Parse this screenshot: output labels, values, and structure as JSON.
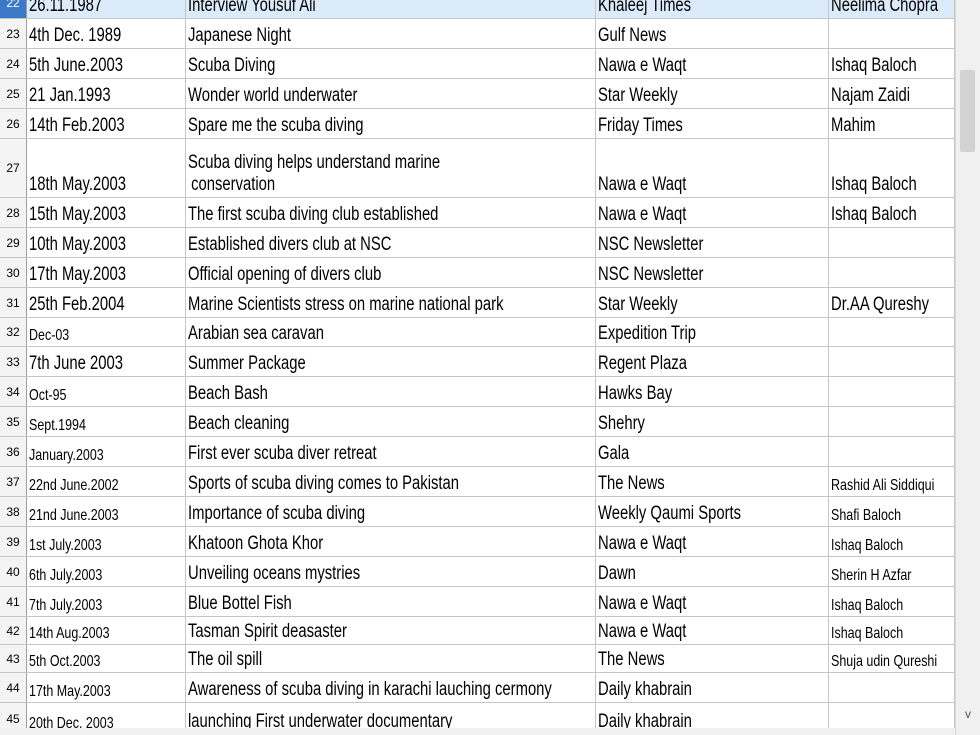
{
  "rows": [
    {
      "n": "22",
      "date": "26.11.1987",
      "title": "Interview Yousuf Ali",
      "source": "Khaleej Times",
      "author": "Neelima Chopra"
    },
    {
      "n": "23",
      "date": "4th Dec. 1989",
      "title": "Japanese Night",
      "source": "Gulf News",
      "author": ""
    },
    {
      "n": "24",
      "date": "5th June.2003",
      "title": "Scuba Diving",
      "source": "Nawa e Waqt",
      "author": "Ishaq Baloch"
    },
    {
      "n": "25",
      "date": "21 Jan.1993",
      "title": "Wonder world underwater",
      "source": "Star Weekly",
      "author": "Najam Zaidi"
    },
    {
      "n": "26",
      "date": "14th Feb.2003",
      "title": "Spare me the scuba diving",
      "source": "Friday Times",
      "author": "Mahim"
    },
    {
      "n": "27",
      "date": "18th May.2003",
      "title": "Scuba diving helps understand marine",
      "title2": "conservation",
      "source": "Nawa e Waqt",
      "author": "Ishaq Baloch"
    },
    {
      "n": "28",
      "date": "15th May.2003",
      "title": "The first scuba diving club established",
      "source": "Nawa e Waqt",
      "author": "Ishaq Baloch"
    },
    {
      "n": "29",
      "date": "10th May.2003",
      "title": "Established divers club at NSC",
      "source": "NSC Newsletter",
      "author": ""
    },
    {
      "n": "30",
      "date": "17th May.2003",
      "title": "Official opening of divers club",
      "source": "NSC Newsletter",
      "author": ""
    },
    {
      "n": "31",
      "date": "25th Feb.2004",
      "title": "Marine Scientists stress on marine national park",
      "source": "Star Weekly",
      "author": "Dr.AA Qureshy"
    },
    {
      "n": "32",
      "date": "Dec-03",
      "title": "Arabian sea caravan",
      "source": "Expedition Trip",
      "author": ""
    },
    {
      "n": "33",
      "date": "7th June 2003",
      "title": "Summer Package",
      "source": "Regent Plaza",
      "author": ""
    },
    {
      "n": "34",
      "date": "Oct-95",
      "title": "Beach Bash",
      "source": "Hawks Bay",
      "author": ""
    },
    {
      "n": "35",
      "date": "Sept.1994",
      "title": "Beach cleaning",
      "source": "Shehry",
      "author": ""
    },
    {
      "n": "36",
      "date": "January.2003",
      "title": "First ever scuba diver retreat",
      "source": "Gala",
      "author": ""
    },
    {
      "n": "37",
      "date": "22nd June.2002",
      "title": "Sports of scuba diving comes to Pakistan",
      "source": "The News",
      "author": "Rashid Ali Siddiqui"
    },
    {
      "n": "38",
      "date": "21nd June.2003",
      "title": "Importance of scuba diving",
      "source": "Weekly Qaumi Sports",
      "author": "Shafi Baloch"
    },
    {
      "n": "39",
      "date": "1st July.2003",
      "title": "Khatoon Ghota Khor",
      "source": "Nawa e Waqt",
      "author": "Ishaq Baloch"
    },
    {
      "n": "40",
      "date": "6th July.2003",
      "title": "Unveiling oceans mystries",
      "source": "Dawn",
      "author": "Sherin H Azfar"
    },
    {
      "n": "41",
      "date": "7th July.2003",
      "title": "Blue Bottel Fish",
      "source": "Nawa e Waqt",
      "author": "Ishaq Baloch"
    },
    {
      "n": "42",
      "date": "14th Aug.2003",
      "title": "Tasman Spirit deasaster",
      "source": "Nawa e Waqt",
      "author": "Ishaq Baloch"
    },
    {
      "n": "43",
      "date": "5th Oct.2003",
      "title": "The oil spill",
      "source": "The News",
      "author": "Shuja udin Qureshi"
    },
    {
      "n": "44",
      "date": "17th May.2003",
      "title": "Awareness of scuba diving in karachi lauching cermony",
      "source": "Daily khabrain",
      "author": ""
    },
    {
      "n": "45",
      "date": "20th Dec. 2003",
      "title": "launching First underwater documentary",
      "source": "Daily khabrain",
      "author": ""
    }
  ],
  "scroll_down_glyph": "v"
}
